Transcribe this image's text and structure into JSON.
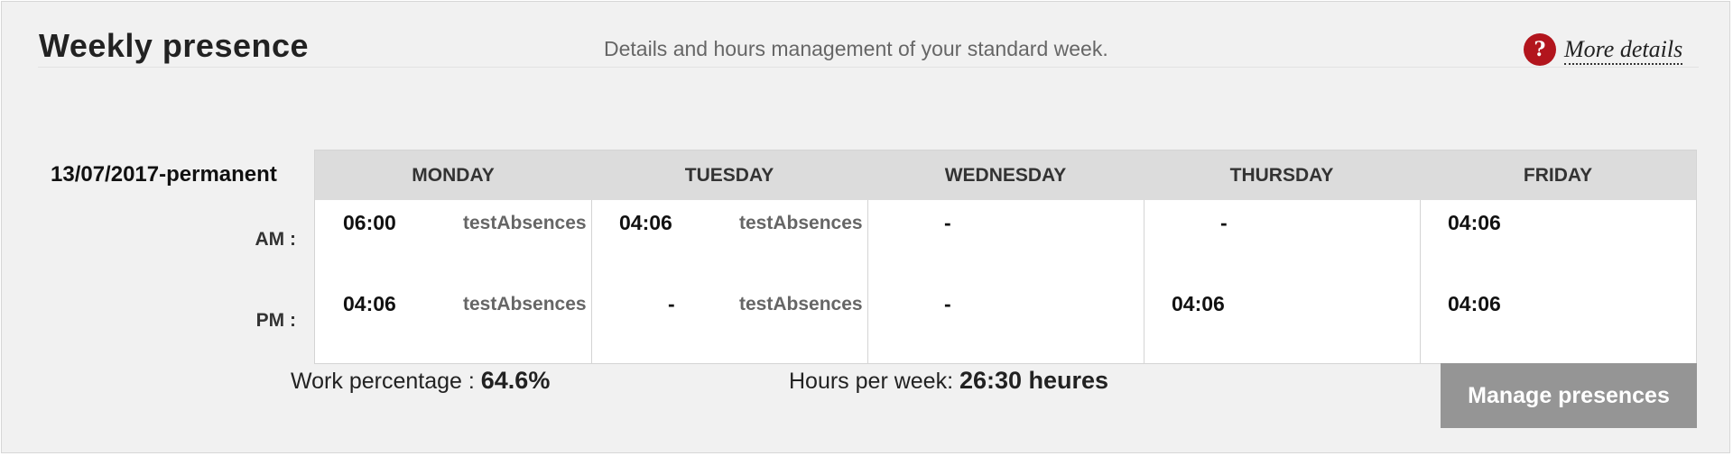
{
  "header": {
    "title": "Weekly presence",
    "subtitle": "Details and hours management of your standard week.",
    "help_icon": "?",
    "more_details": "More details"
  },
  "schedule": {
    "period": "13/07/2017-permanent",
    "am_label": "AM :",
    "pm_label": "PM :",
    "days": [
      {
        "name": "MONDAY",
        "am_time": "06:00",
        "am_absence": "testAbsences",
        "pm_time": "04:06",
        "pm_absence": "testAbsences"
      },
      {
        "name": "TUESDAY",
        "am_time": "04:06",
        "am_absence": "testAbsences",
        "pm_time": "-",
        "pm_absence": "testAbsences"
      },
      {
        "name": "WEDNESDAY",
        "am_time": "-",
        "am_absence": "",
        "pm_time": "-",
        "pm_absence": ""
      },
      {
        "name": "THURSDAY",
        "am_time": "-",
        "am_absence": "",
        "pm_time": "04:06",
        "pm_absence": ""
      },
      {
        "name": "FRIDAY",
        "am_time": "04:06",
        "am_absence": "",
        "pm_time": "04:06",
        "pm_absence": ""
      }
    ]
  },
  "footer": {
    "work_percentage_label": "Work percentage : ",
    "work_percentage_value": "64.6%",
    "hours_label": "Hours per week: ",
    "hours_value": "26:30 heures",
    "manage_button": "Manage presences"
  },
  "colors": {
    "accent": "#b2151d",
    "button": "#959595",
    "header_bg": "#dcdcdc"
  }
}
